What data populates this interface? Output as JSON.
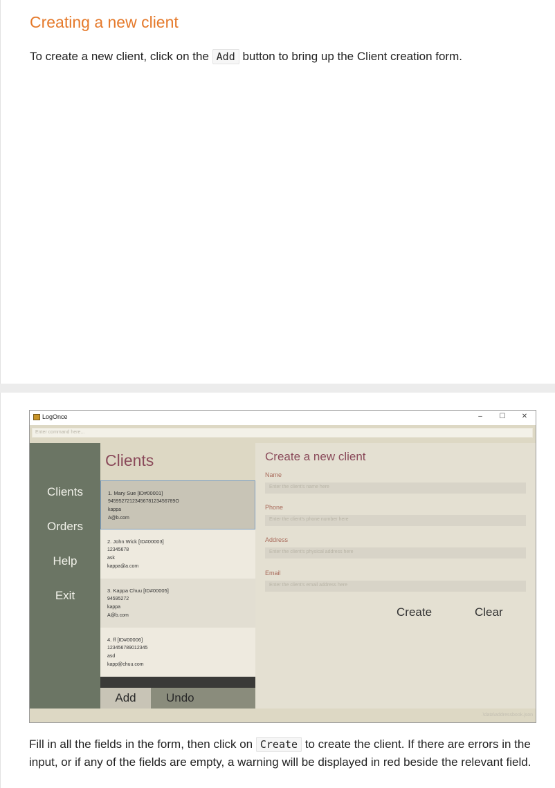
{
  "section": {
    "title": "Creating a new client"
  },
  "intro": {
    "before": "To create a new client, click on the ",
    "code": "Add",
    "after": " button to bring up the Client creation form."
  },
  "window": {
    "title": "LogOnce",
    "controls": {
      "minimize": "–",
      "maximize": "☐",
      "close": "✕"
    },
    "command_placeholder": "Enter command here...",
    "status_path": ".\\data\\addressbook.json"
  },
  "nav": {
    "items": [
      "Clients",
      "Orders",
      "Help",
      "Exit"
    ]
  },
  "clients_panel": {
    "title": "Clients",
    "clients": [
      {
        "header": "1.  Mary Sue [ID#00001]",
        "phone": "9459527212345678123456789O",
        "address": "kappa",
        "email": "A@b.com"
      },
      {
        "header": "2.  John Wick [ID#00003]",
        "phone": "12345678",
        "address": "ask",
        "email": "kappa@a.com"
      },
      {
        "header": "3.  Kappa Chuu [ID#00005]",
        "phone": "94595272",
        "address": "kappa",
        "email": "A@b.com"
      },
      {
        "header": "4.  ff [ID#00006]",
        "phone": "123456789012345",
        "address": "asd",
        "email": "kapp@chuu.com"
      }
    ],
    "add_label": "Add",
    "undo_label": "Undo"
  },
  "form": {
    "title": "Create a new client",
    "name_label": "Name",
    "name_placeholder": "Enter the client's name here",
    "phone_label": "Phone",
    "phone_placeholder": "Enter the client's phone number here",
    "address_label": "Address",
    "address_placeholder": "Enter the client's physical address here",
    "email_label": "Email",
    "email_placeholder": "Enter the client's email address here",
    "create_label": "Create",
    "clear_label": "Clear"
  },
  "outro": {
    "before": "Fill in all the fields in the form, then click on ",
    "code": "Create",
    "after": " to create the client. If there are errors in the input, or if any of the fields are empty, a warning will be displayed in red beside the relevant field."
  }
}
